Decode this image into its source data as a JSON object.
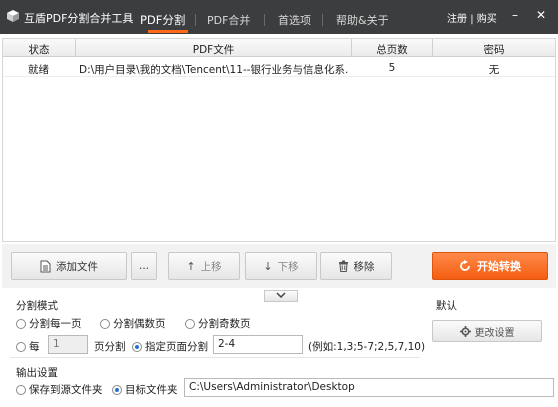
{
  "app": {
    "title": "互盾PDF分割合并工具"
  },
  "tabs": [
    {
      "label": "PDF分割",
      "active": true
    },
    {
      "label": "PDF合并",
      "active": false
    },
    {
      "label": "首选项",
      "active": false
    },
    {
      "label": "帮助&关于",
      "active": false
    }
  ],
  "user_links": {
    "register": "注册",
    "separator": "|",
    "buy": "购买"
  },
  "window": {
    "minimize": "–",
    "close": "✕"
  },
  "table": {
    "columns": [
      "状态",
      "PDF文件",
      "总页数",
      "密码"
    ],
    "rows": [
      {
        "status": "就绪",
        "file": "D:\\用户目录\\我的文档\\Tencent\\11--银行业务与信息化系...",
        "pages": "5",
        "password": "无"
      }
    ]
  },
  "toolbar": {
    "add_file": "添加文件",
    "more": "...",
    "move_up": "上移",
    "move_down": "下移",
    "remove": "移除",
    "start": "开始转换"
  },
  "split": {
    "title": "分割模式",
    "per_page": "分割每一页",
    "even_pages": "分割偶数页",
    "odd_pages": "分割奇数页",
    "every_prefix": "每",
    "every_value": "1",
    "every_suffix": "页分割",
    "specified": "指定页面分割",
    "range_value": "2-4",
    "example": "(例如:1,3;5-7;2,5,7,10)",
    "selected": "specified"
  },
  "default_panel": {
    "title": "默认",
    "change_settings": "更改设置"
  },
  "output": {
    "title": "输出设置",
    "save_to_source": "保存到源文件夹",
    "target_folder": "目标文件夹",
    "path": "C:\\Users\\Administrator\\Desktop",
    "selected": "target"
  },
  "colors": {
    "titlebar": "#3c3d3f",
    "accent": "#f45d10",
    "radio_selected": "#2a6fd6"
  },
  "icons": {
    "logo": "cube-logo-icon",
    "add_file": "document-icon",
    "move_up": "arrow-up-icon",
    "move_down": "arrow-down-icon",
    "remove": "trash-icon",
    "start": "refresh-icon",
    "collapse": "chevron-down-icon",
    "settings": "gear-icon"
  }
}
